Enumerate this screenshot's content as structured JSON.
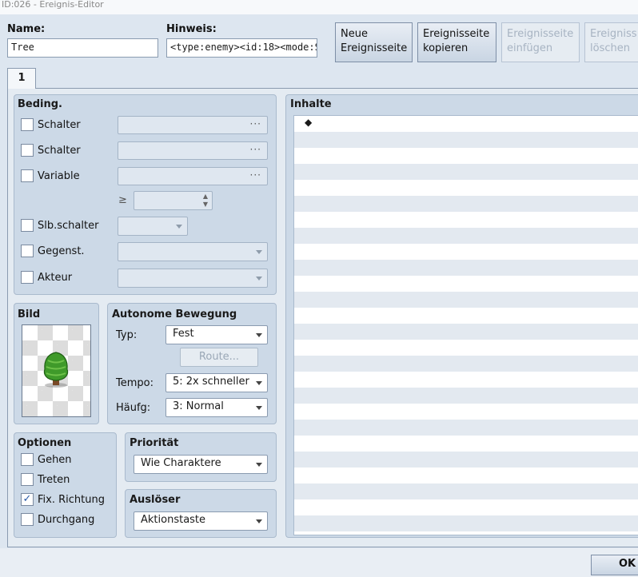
{
  "window": {
    "title": "ID:026 - Ereignis-Editor"
  },
  "header": {
    "name_label": "Name:",
    "name_value": "Tree",
    "hint_label": "Hinweis:",
    "hint_value": "<type:enemy><id:18><mode:S",
    "buttons": {
      "new_page": [
        "Neue",
        "Ereignisseite"
      ],
      "copy_page": [
        "Ereignisseite",
        "kopieren"
      ],
      "paste_page": [
        "Ereignisseite",
        "einfügen"
      ],
      "delete_page": [
        "Ereigniss",
        "löschen"
      ]
    }
  },
  "tabs": [
    {
      "label": "1",
      "selected": true
    }
  ],
  "conditions": {
    "title": "Beding.",
    "switch1": {
      "label": "Schalter",
      "checked": false
    },
    "switch2": {
      "label": "Schalter",
      "checked": false
    },
    "variable": {
      "label": "Variable",
      "checked": false
    },
    "ge_symbol": "≥",
    "self_switch": {
      "label": "Slb.schalter",
      "checked": false
    },
    "item": {
      "label": "Gegenst.",
      "checked": false
    },
    "actor": {
      "label": "Akteur",
      "checked": false
    },
    "ellipsis": "···"
  },
  "image": {
    "title": "Bild",
    "sprite": "tree-sprite"
  },
  "autonomous_movement": {
    "title": "Autonome Bewegung",
    "type_label": "Typ:",
    "type_value": "Fest",
    "route_button": "Route...",
    "speed_label": "Tempo:",
    "speed_value": "5: 2x schneller",
    "freq_label": "Häufg:",
    "freq_value": "3: Normal"
  },
  "options": {
    "title": "Optionen",
    "walk": {
      "label": "Gehen",
      "checked": false
    },
    "step": {
      "label": "Treten",
      "checked": false
    },
    "direction_fix": {
      "label": "Fix. Richtung",
      "checked": true
    },
    "through": {
      "label": "Durchgang",
      "checked": false
    },
    "check_mark": "✓"
  },
  "priority": {
    "title": "Priorität",
    "value": "Wie Charaktere"
  },
  "trigger": {
    "title": "Auslöser",
    "value": "Aktionstaste"
  },
  "contents": {
    "title": "Inhalte",
    "first_line": "◆"
  },
  "footer": {
    "ok_button": "OK"
  },
  "colors": {
    "background": "#dde6f0",
    "group": "#ccd9e7",
    "accent": "#2a5aa8"
  }
}
